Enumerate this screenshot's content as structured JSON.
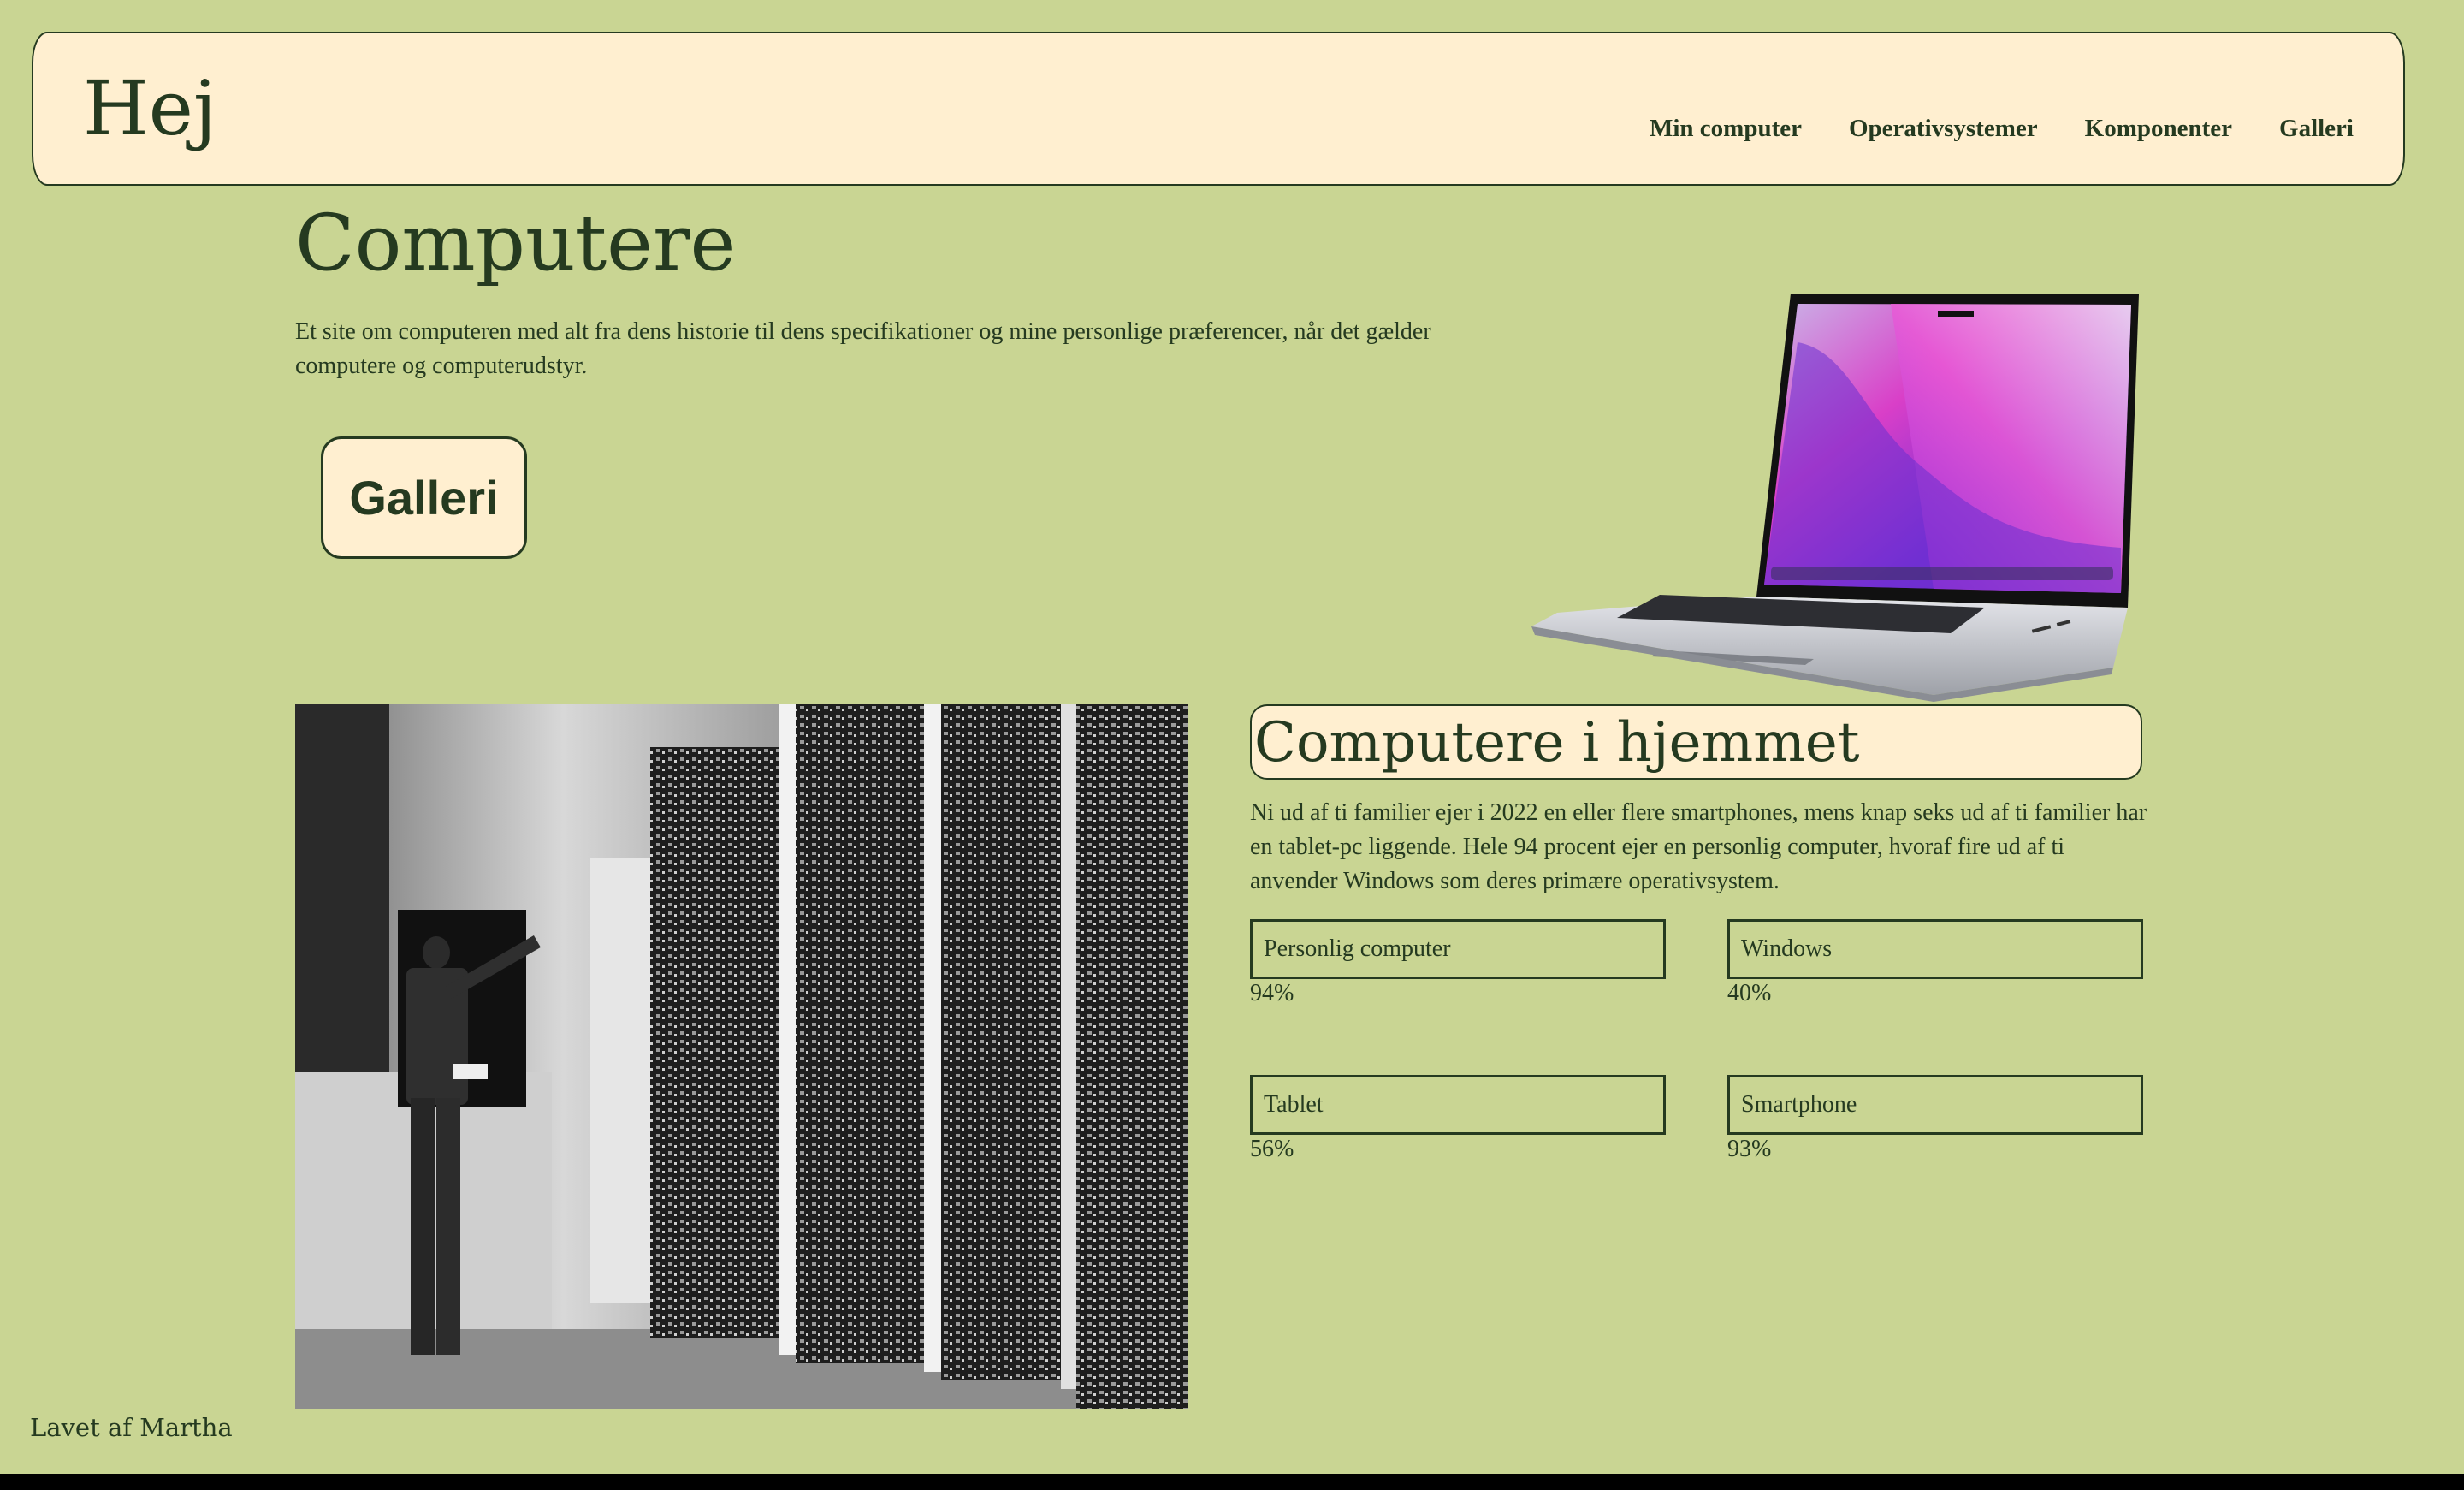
{
  "header": {
    "brand": "Hej",
    "nav": [
      "Min computer",
      "Operativsystemer",
      "Komponenter",
      "Galleri"
    ]
  },
  "hero": {
    "title": "Computere",
    "text": "Et site om computeren med alt fra dens historie til dens specifikationer og mine personlige præferencer, når det gælder computere og computerudstyr.",
    "button": "Galleri"
  },
  "section": {
    "title": "Computere i hjemmet",
    "text": "Ni ud af ti familier ejer i 2022 en eller flere smartphones, mens knap seks ud af ti familier har en tablet-pc liggende. Hele 94 procent ejer en personlig computer, hvoraf fire ud af ti anvender Windows som deres primære operativsystem.",
    "stats": [
      {
        "label": "Personlig computer",
        "value": "94%"
      },
      {
        "label": "Windows",
        "value": "40%"
      },
      {
        "label": "Tablet",
        "value": "56%"
      },
      {
        "label": "Smartphone",
        "value": "93%"
      }
    ]
  },
  "footer": {
    "text": "Lavet af Martha"
  },
  "colors": {
    "background": "#c9d593",
    "panel": "#ffefd0",
    "ink": "#253a20"
  }
}
